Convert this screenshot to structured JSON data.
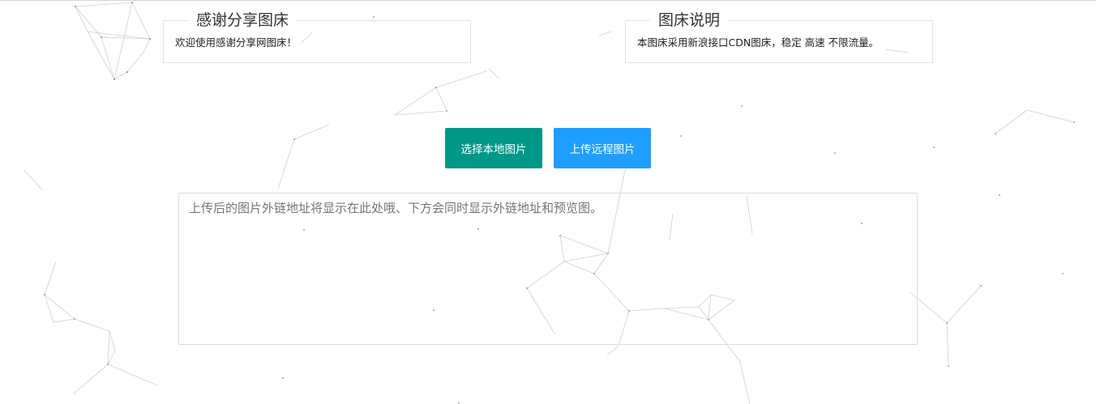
{
  "panels": {
    "left": {
      "title": "感谢分享图床",
      "text": "欢迎使用感谢分享网图床！"
    },
    "right": {
      "title": "图床说明",
      "text": "本图床采用新浪接口CDN图床，稳定 高速 不限流量。"
    }
  },
  "buttons": {
    "local_label": "选择本地图片",
    "remote_label": "上传远程图片"
  },
  "result": {
    "value": "",
    "placeholder": "上传后的图片外链地址将显示在此处哦、下方会同时显示外链地址和预览图。"
  },
  "colors": {
    "local_button": "#009688",
    "remote_button": "#1E9FFF"
  }
}
